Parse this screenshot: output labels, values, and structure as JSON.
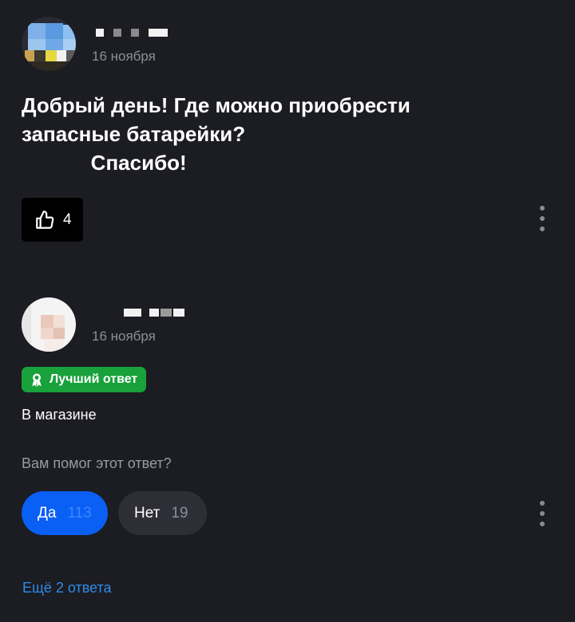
{
  "post": {
    "date": "16 ноября",
    "question_lines": [
      "Добрый день! Где можно приобрести",
      "запасные батарейки?",
      "            Спасибо!"
    ],
    "likes": "4"
  },
  "answer": {
    "date": "16 ноября",
    "badge": "Лучший ответ",
    "text": "В магазине",
    "helpful_question": "Вам помог этот ответ?",
    "yes_label": "Да",
    "yes_count": "113",
    "no_label": "Нет",
    "no_count": "19"
  },
  "more_answers": "Ещё 2 ответа",
  "colors": {
    "background": "#1c1c23",
    "accent_blue": "#0a5ff5",
    "best_answer_green": "#19a13c",
    "link": "#2e8be8"
  },
  "icons": [
    "thumbs-up-icon",
    "award-icon",
    "kebab-menu-icon"
  ]
}
